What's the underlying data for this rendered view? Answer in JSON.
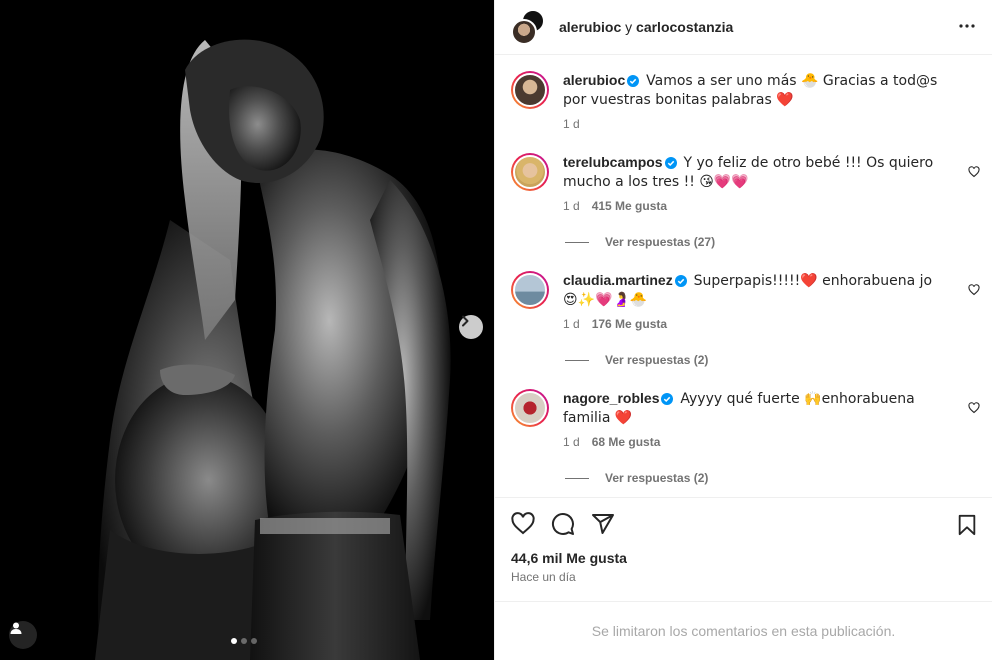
{
  "header": {
    "user_a": "alerubioc",
    "separator": "y",
    "user_b": "carlocostanzia"
  },
  "caption": {
    "username": "alerubioc",
    "text": "Vamos a ser uno más 🐣 Gracias a tod@s por vuestras bonitas palabras ❤️",
    "time": "1 d"
  },
  "comments": [
    {
      "username": "terelubcampos",
      "text": "Y yo feliz de otro bebé !!! Os quiero mucho a los tres !! 😘💗💗",
      "time": "1 d",
      "likes": "415 Me gusta",
      "replies": "Ver respuestas (27)"
    },
    {
      "username": "claudia.martinez",
      "text": "Superpapis!!!!!❤️ enhorabuena jo 😍✨💗🤰🐣",
      "time": "1 d",
      "likes": "176 Me gusta",
      "replies": "Ver respuestas (2)"
    },
    {
      "username": "nagore_robles",
      "text": "Ayyyy qué fuerte 🙌enhorabuena familia ❤️",
      "time": "1 d",
      "likes": "68 Me gusta",
      "replies": "Ver respuestas (2)"
    }
  ],
  "post": {
    "likes": "44,6 mil Me gusta",
    "time_ago": "Hace un día",
    "comments_limited": "Se limitaron los comentarios en esta publicación."
  },
  "carousel": {
    "total_slides": 3,
    "current_slide": 1
  },
  "icons": [
    "more-icon",
    "verified-icon",
    "heart-icon",
    "comment-icon",
    "share-icon",
    "bookmark-icon",
    "chevron-right-icon",
    "user-tag-icon"
  ],
  "colors": {
    "verified": "#0095f6",
    "text": "#262626",
    "muted": "#737373",
    "border": "#efefef"
  }
}
